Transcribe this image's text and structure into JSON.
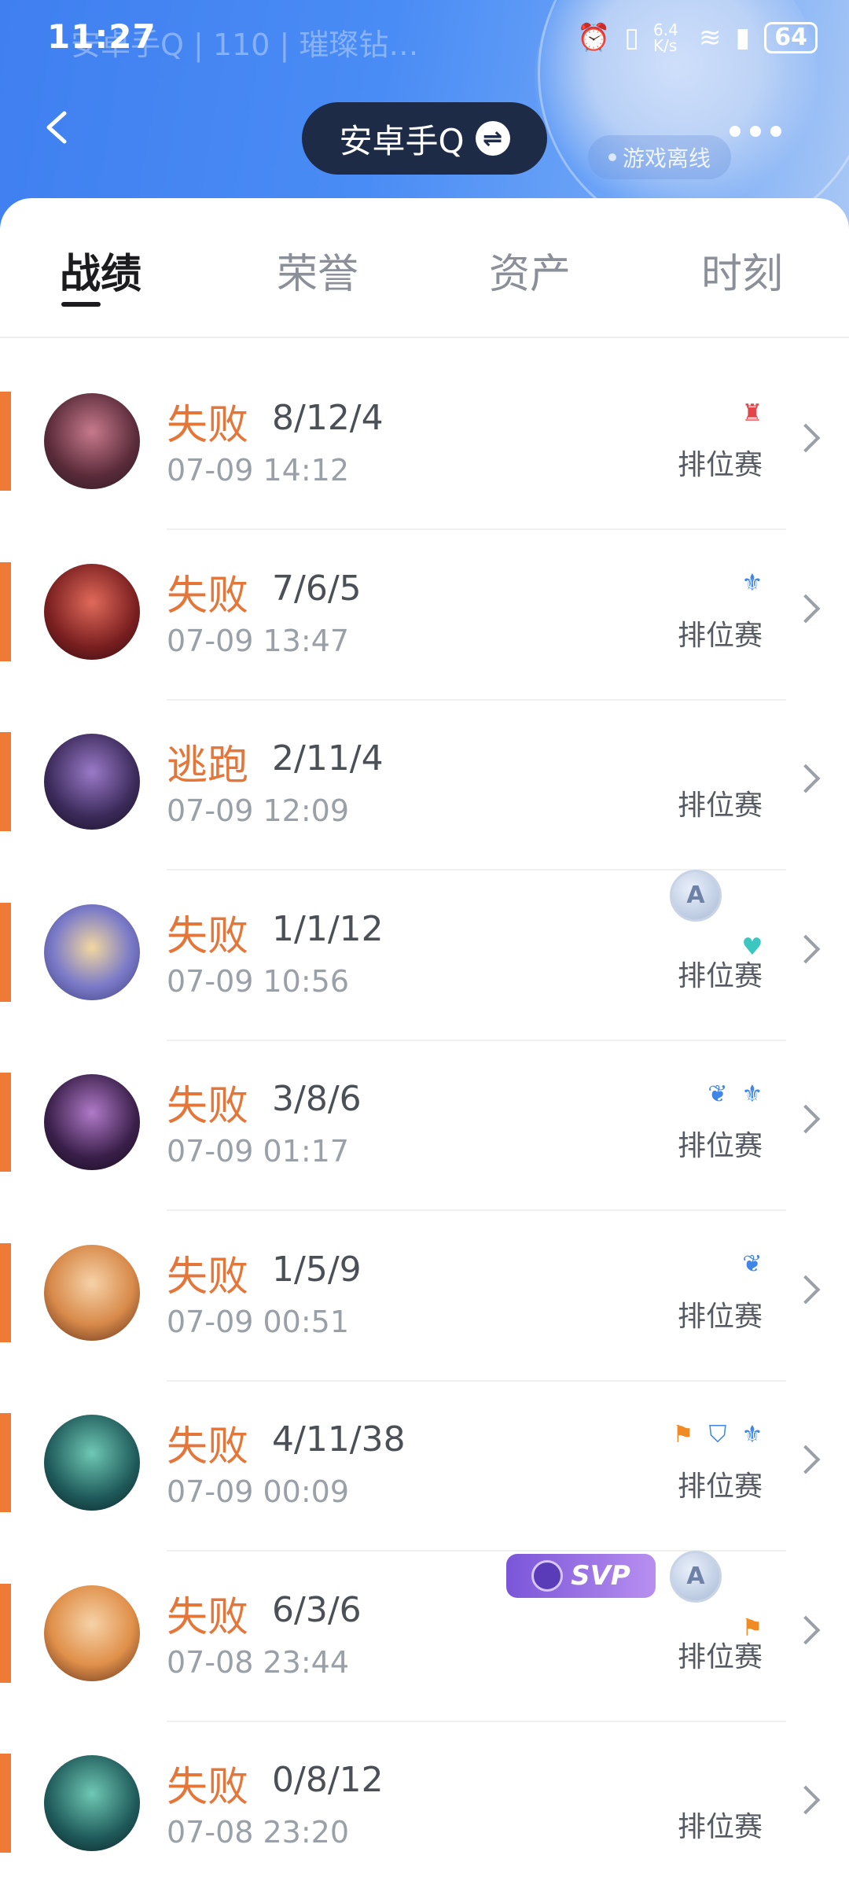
{
  "statusbar": {
    "time": "11:27",
    "ghost_text": "安卓手Q | 110 | 璀璨钻…",
    "speed": "6.4 K/s",
    "battery": "64"
  },
  "header": {
    "title": "安卓手Q",
    "swap_symbol": "⇌",
    "status": "游戏离线"
  },
  "tabs": [
    {
      "label": "战绩",
      "active": true
    },
    {
      "label": "荣誉",
      "active": false
    },
    {
      "label": "资产",
      "active": false
    },
    {
      "label": "时刻",
      "active": false
    }
  ],
  "matches": [
    {
      "result": "失败",
      "kda": "8/12/4",
      "time": "07-09 14:12",
      "mode": "排位赛",
      "badges": [
        "red-emblem-icon"
      ]
    },
    {
      "result": "失败",
      "kda": "7/6/5",
      "time": "07-09 13:47",
      "mode": "排位赛",
      "badges": [
        "blue-wing-icon"
      ]
    },
    {
      "result": "逃跑",
      "kda": "2/11/4",
      "time": "07-09 12:09",
      "mode": "排位赛",
      "badges": []
    },
    {
      "result": "失败",
      "kda": "1/1/12",
      "time": "07-09 10:56",
      "mode": "排位赛",
      "badges": [
        "a-medal-icon",
        "heart-plus-icon"
      ]
    },
    {
      "result": "失败",
      "kda": "3/8/6",
      "time": "07-09 01:17",
      "mode": "排位赛",
      "badges": [
        "blue-lotus-icon",
        "blue-wing-icon"
      ]
    },
    {
      "result": "失败",
      "kda": "1/5/9",
      "time": "07-09 00:51",
      "mode": "排位赛",
      "badges": [
        "blue-lotus-icon"
      ]
    },
    {
      "result": "失败",
      "kda": "4/11/38",
      "time": "07-09 00:09",
      "mode": "排位赛",
      "badges": [
        "orange-flag-icon",
        "blue-shield-icon",
        "blue-wing-icon"
      ]
    },
    {
      "result": "失败",
      "kda": "6/3/6",
      "time": "07-08 23:44",
      "mode": "排位赛",
      "badges": [
        "svp-badge",
        "a-medal-icon",
        "orange-flag-icon"
      ]
    },
    {
      "result": "失败",
      "kda": "0/8/12",
      "time": "07-08 23:20",
      "mode": "排位赛",
      "badges": []
    }
  ],
  "svp_label": "SVP",
  "medal_label": "A",
  "colors": {
    "accent": "#ef7a35",
    "header_blue": "#4a8cf5",
    "pill": "#1e2b46"
  }
}
